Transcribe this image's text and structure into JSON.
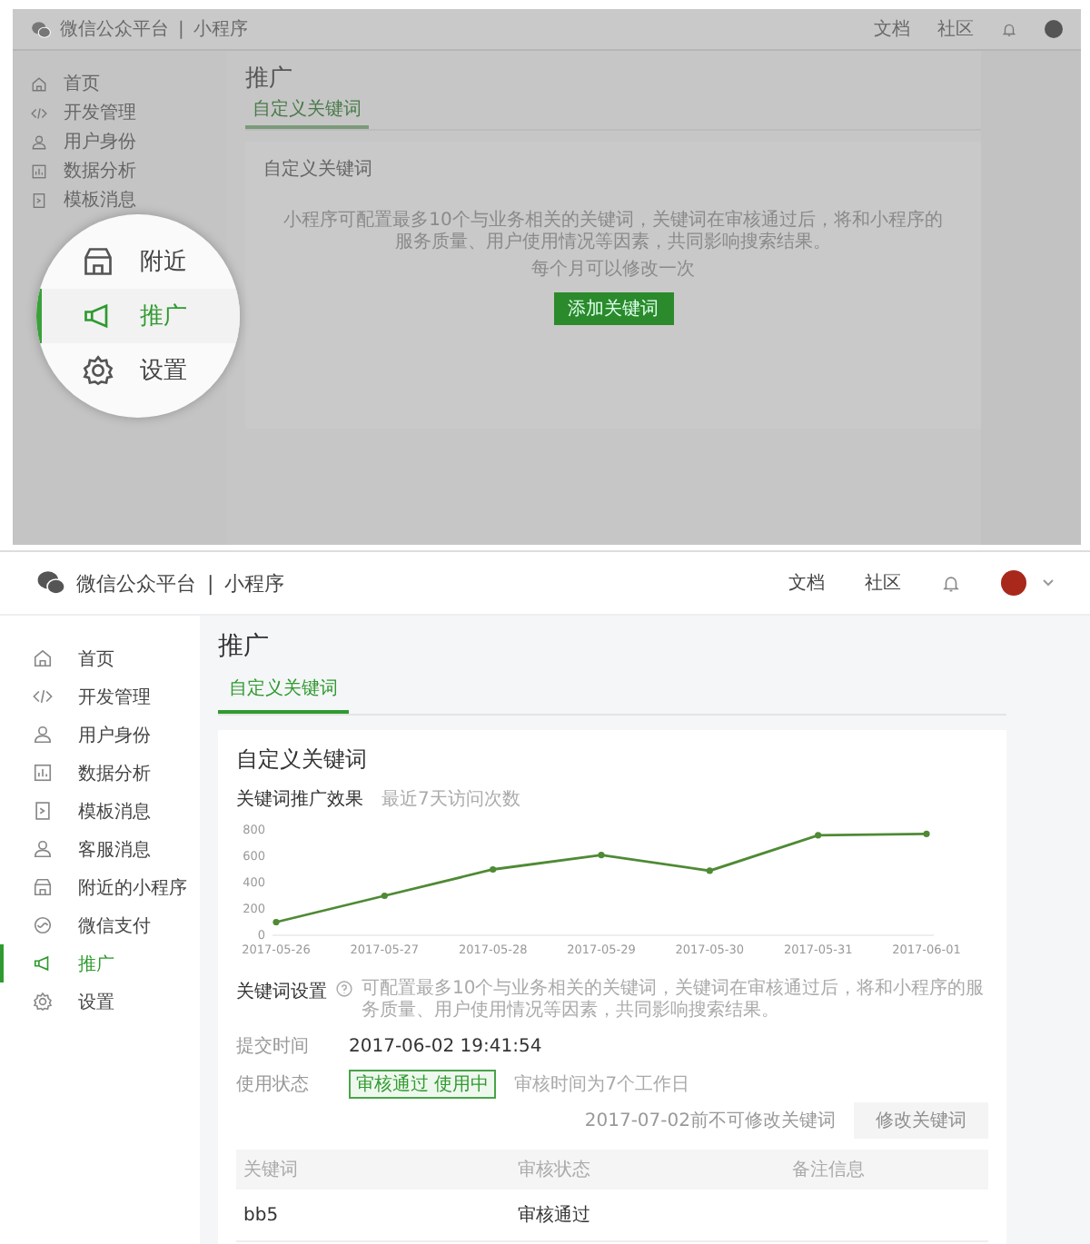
{
  "background_screen": {
    "header": {
      "brand": "微信公众平台",
      "separator": "|",
      "product": "小程序",
      "links": [
        {
          "label": "文档"
        },
        {
          "label": "社区"
        }
      ]
    },
    "sidebar": {
      "items": [
        {
          "label": "首页",
          "selected": false
        },
        {
          "label": "开发管理",
          "selected": false
        },
        {
          "label": "用户身份",
          "selected": false
        },
        {
          "label": "数据分析",
          "selected": false
        },
        {
          "label": "模板消息",
          "selected": false
        }
      ]
    },
    "page_title": "推广",
    "tabs": [
      {
        "label": "自定义关键词",
        "selected": true
      }
    ],
    "card": {
      "title": "自定义关键词",
      "description": "小程序可配置最多10个与业务相关的关键词，关键词在审核通过后，将和小程序的服务质量、用户使用情况等因素，共同影响搜索结果。",
      "note": "每个月可以修改一次",
      "button": "添加关键词"
    },
    "magnifier": {
      "items": [
        {
          "label": "附近",
          "selected": false
        },
        {
          "label": "推广",
          "selected": true
        },
        {
          "label": "设置",
          "selected": false
        }
      ]
    }
  },
  "screen": {
    "header": {
      "brand": "微信公众平台",
      "separator": "|",
      "product": "小程序",
      "links": [
        {
          "label": "文档"
        },
        {
          "label": "社区"
        }
      ]
    },
    "sidebar": {
      "items": [
        {
          "label": "首页",
          "selected": false
        },
        {
          "label": "开发管理",
          "selected": false
        },
        {
          "label": "用户身份",
          "selected": false
        },
        {
          "label": "数据分析",
          "selected": false
        },
        {
          "label": "模板消息",
          "selected": false
        },
        {
          "label": "客服消息",
          "selected": false
        },
        {
          "label": "附近的小程序",
          "selected": false
        },
        {
          "label": "微信支付",
          "selected": false
        },
        {
          "label": "推广",
          "selected": true
        },
        {
          "label": "设置",
          "selected": false
        }
      ]
    },
    "page_title": "推广",
    "tabs": [
      {
        "label": "自定义关键词",
        "selected": true
      }
    ],
    "card": {
      "title": "自定义关键词",
      "chart_data": {
        "type": "line",
        "title": "关键词推广效果",
        "categories": [
          "2017-05-26",
          "2017-05-27",
          "2017-05-28",
          "2017-05-29",
          "2017-05-30",
          "2017-05-31",
          "2017-06-01"
        ],
        "ylim": [
          0,
          800
        ],
        "yticks": [
          0,
          200,
          400,
          600,
          800
        ],
        "series": [
          {
            "name": "最近7天访问次数",
            "color": "#4f8a35",
            "marker": "circle",
            "values": [
              100,
              300,
              500,
              610,
              490,
              760,
              770
            ]
          }
        ]
      },
      "settings": {
        "title": "关键词设置",
        "description": "可配置最多10个与业务相关的关键词，关键词在审核通过后，将和小程序的服务质量、用户使用情况等因素，共同影响搜索结果。",
        "submit_label": "提交时间",
        "submit_value": "2017-06-02 19:41:54",
        "status_label": "使用状态",
        "status_badge": "审核通过 使用中",
        "status_note": "审核时间为7个工作日",
        "modify_notice": "2017-07-02前不可修改关键词",
        "modify_button": {
          "label": "修改关键词",
          "disabled": true
        },
        "table": {
          "columns": [
            "关键词",
            "审核状态",
            "备注信息"
          ],
          "rows": [
            [
              "bb5",
              "审核通过"
            ]
          ]
        }
      }
    }
  }
}
